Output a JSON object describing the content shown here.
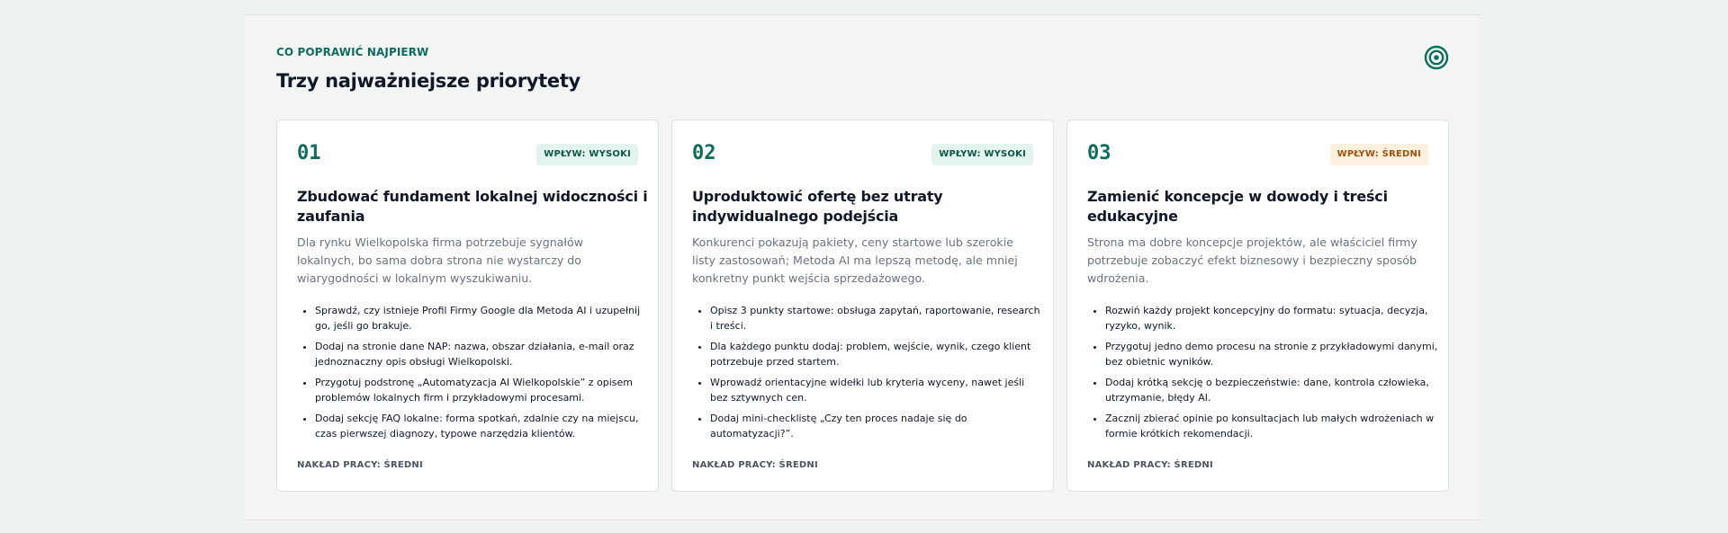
{
  "section": {
    "eyebrow": "CO POPRAWIĆ NAJPIERW",
    "title": "Trzy najważniejsze priorytety",
    "icon": "target-icon",
    "accent_color": "#0f6b5c"
  },
  "cards": [
    {
      "number": "01",
      "badge": "WPŁYW: WYSOKI",
      "badge_level": "high",
      "title": "Zbudować fundament lokalnej widoczności i zaufania",
      "description": "Dla rynku Wielkopolska firma potrzebuje sygnałów lokalnych, bo sama dobra strona nie wystarczy do wiarygodności w lokalnym wyszukiwaniu.",
      "items": [
        "Sprawdź, czy istnieje Profil Firmy Google dla Metoda AI i uzupełnij go, jeśli go brakuje.",
        "Dodaj na stronie dane NAP: nazwa, obszar działania, e-mail oraz jednoznaczny opis obsługi Wielkopolski.",
        "Przygotuj podstronę „Automatyzacja AI Wielkopolskie” z opisem problemów lokalnych firm i przykładowymi procesami.",
        "Dodaj sekcję FAQ lokalne: forma spotkań, zdalnie czy na miejscu, czas pierwszej diagnozy, typowe narzędzia klientów."
      ],
      "effort": "NAKŁAD PRACY: ŚREDNI"
    },
    {
      "number": "02",
      "badge": "WPŁYW: WYSOKI",
      "badge_level": "high",
      "title": "Uproduktowić ofertę bez utraty indywidualnego podejścia",
      "description": "Konkurenci pokazują pakiety, ceny startowe lub szerokie listy zastosowań; Metoda AI ma lepszą metodę, ale mniej konkretny punkt wejścia sprzedażowego.",
      "items": [
        "Opisz 3 punkty startowe: obsługa zapytań, raportowanie, research i treści.",
        "Dla każdego punktu dodaj: problem, wejście, wynik, czego klient potrzebuje przed startem.",
        "Wprowadź orientacyjne widełki lub kryteria wyceny, nawet jeśli bez sztywnych cen.",
        "Dodaj mini-checklistę „Czy ten proces nadaje się do automatyzacji?”."
      ],
      "effort": "NAKŁAD PRACY: ŚREDNI"
    },
    {
      "number": "03",
      "badge": "WPŁYW: ŚREDNI",
      "badge_level": "mid",
      "title": "Zamienić koncepcje w dowody i treści edukacyjne",
      "description": "Strona ma dobre koncepcje projektów, ale właściciel firmy potrzebuje zobaczyć efekt biznesowy i bezpieczny sposób wdrożenia.",
      "items": [
        "Rozwiń każdy projekt koncepcyjny do formatu: sytuacja, decyzja, ryzyko, wynik.",
        "Przygotuj jedno demo procesu na stronie z przykładowymi danymi, bez obietnic wyników.",
        "Dodaj krótką sekcję o bezpieczeństwie: dane, kontrola człowieka, utrzymanie, błędy AI.",
        "Zacznij zbierać opinie po konsultacjach lub małych wdrożeniach w formie krótkich rekomendacji."
      ],
      "effort": "NAKŁAD PRACY: ŚREDNI"
    }
  ]
}
